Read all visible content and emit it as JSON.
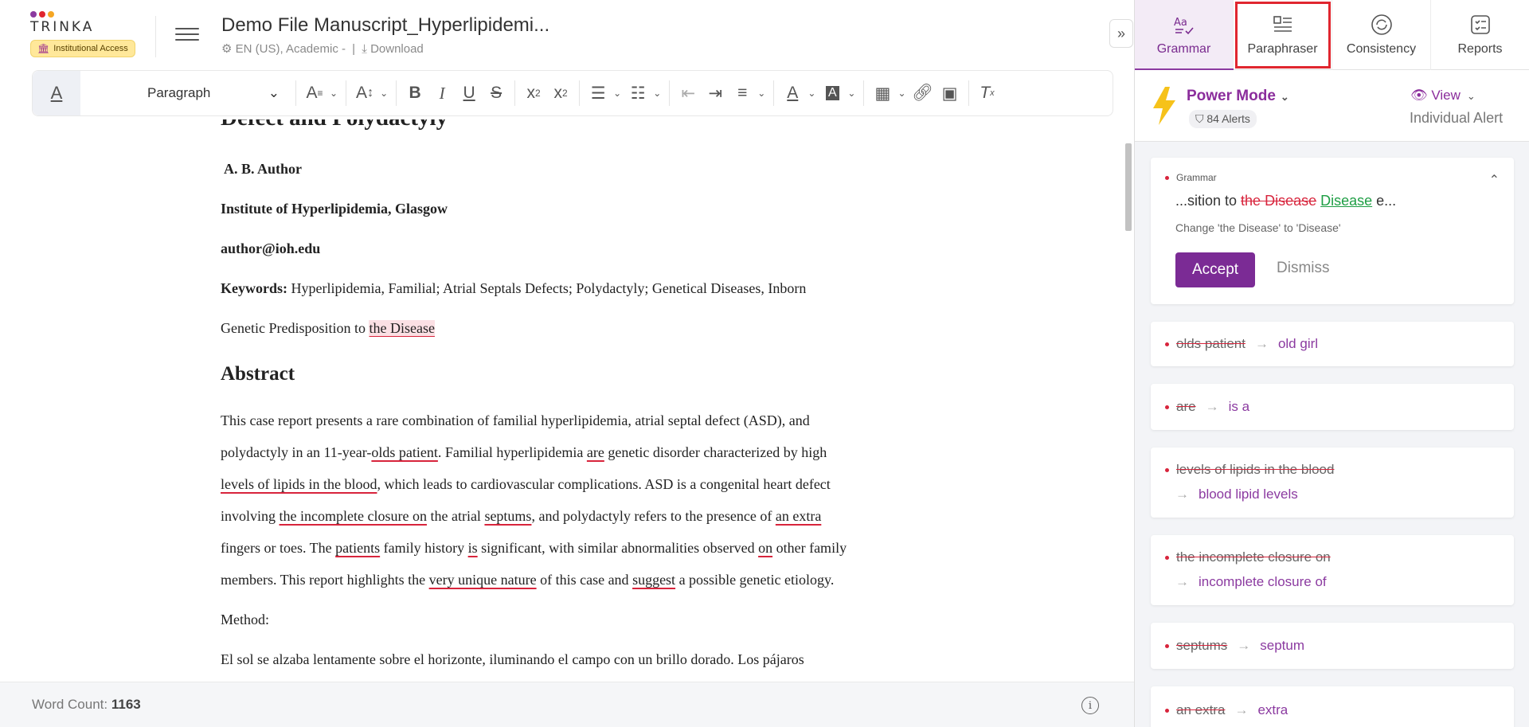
{
  "header": {
    "logo": "TRINKA",
    "logo_dots": [
      "#8b3aa0",
      "#e0262f",
      "#f5a623"
    ],
    "institutional_badge": "Institutional Access",
    "doc_title": "Demo File Manuscript_Hyperlipidemi...",
    "language": "EN (US), Academic -",
    "separator": "|",
    "download": "Download"
  },
  "toolbar": {
    "paragraph_style": "Paragraph",
    "icons": [
      "format-text-icon",
      "font-size-icon",
      "line-height-icon",
      "bold-icon",
      "italic-icon",
      "underline-icon",
      "strikethrough-icon",
      "subscript-icon",
      "superscript-icon",
      "bullet-list-icon",
      "numbered-list-icon",
      "outdent-icon",
      "indent-icon",
      "align-icon",
      "font-color-icon",
      "highlight-color-icon",
      "table-icon",
      "link-icon",
      "image-icon",
      "clear-format-icon"
    ]
  },
  "document": {
    "heading_partial": "Defect and Polydactyly",
    "author": "A. B. Author",
    "institute": "Institute of Hyperlipidemia, Glasgow",
    "email": "author@ioh.edu",
    "keywords_label": "Keywords:",
    "keywords_text": "Hyperlipidemia, Familial; Atrial Septals Defects; Polydactyly; Genetical Diseases, Inborn",
    "genetic_pre": "Genetic Predisposition to ",
    "genetic_err": "the Disease",
    "abstract_heading": "Abstract",
    "p1": "This case report presents a rare combination of familial hyperlipidemia, atrial septal defect (ASD), and",
    "p2_a": "polydactyly in an 11-year-",
    "p2_err1": "olds patient",
    "p2_b": ". Familial hyperlipidemia ",
    "p2_err2": "are",
    "p2_c": " genetic disorder characterized by high",
    "p3_err": "levels of lipids in the blood",
    "p3_b": ", which leads to cardiovascular complications. ASD is a congenital heart defect",
    "p4_a": "involving ",
    "p4_err1": "the incomplete closure on",
    "p4_b": " the atrial ",
    "p4_err2": "septums",
    "p4_c": ", and polydactyly refers to the presence of ",
    "p4_err3": "an extra",
    "p5_a": "fingers or toes. The ",
    "p5_err1": "patients",
    "p5_b": " family history ",
    "p5_err2": "is",
    "p5_c": " significant, with similar abnormalities observed ",
    "p5_err3": "on",
    "p5_d": " other family",
    "p6_a": "members. This report highlights the ",
    "p6_err1": "very unique nature",
    "p6_b": " of this case and ",
    "p6_err2": "suggest",
    "p6_c": " a possible genetic etiology.",
    "method": "Method:",
    "spanish": "El sol se alzaba lentamente sobre el horizonte, iluminando el campo con un brillo dorado. Los pájaros"
  },
  "footer": {
    "word_count_label": "Word Count:",
    "word_count": "1163"
  },
  "panel": {
    "tabs": [
      {
        "label": "Grammar",
        "icon": "grammar-icon"
      },
      {
        "label": "Paraphraser",
        "icon": "paraphraser-icon"
      },
      {
        "label": "Consistency",
        "icon": "consistency-icon"
      },
      {
        "label": "Reports",
        "icon": "reports-icon"
      }
    ],
    "mode": "Power Mode",
    "alerts": "84 Alerts",
    "view": "View",
    "view_mode": "Individual Alert",
    "active_card": {
      "category": "Grammar",
      "preview_pre": "...sition to ",
      "preview_del": "the Disease",
      "preview_ins": "Disease",
      "preview_post": " e...",
      "description": "Change 'the Disease' to 'Disease'",
      "accept": "Accept",
      "dismiss": "Dismiss"
    },
    "suggestions": [
      {
        "old": "olds patient",
        "new": "old girl"
      },
      {
        "old": "are",
        "new": "is a"
      },
      {
        "old": "levels of lipids in the blood",
        "new": "blood lipid levels"
      },
      {
        "old": "the incomplete closure on",
        "new": "incomplete closure of"
      },
      {
        "old": "septums",
        "new": "septum"
      },
      {
        "old": "an extra",
        "new": "extra"
      }
    ]
  }
}
